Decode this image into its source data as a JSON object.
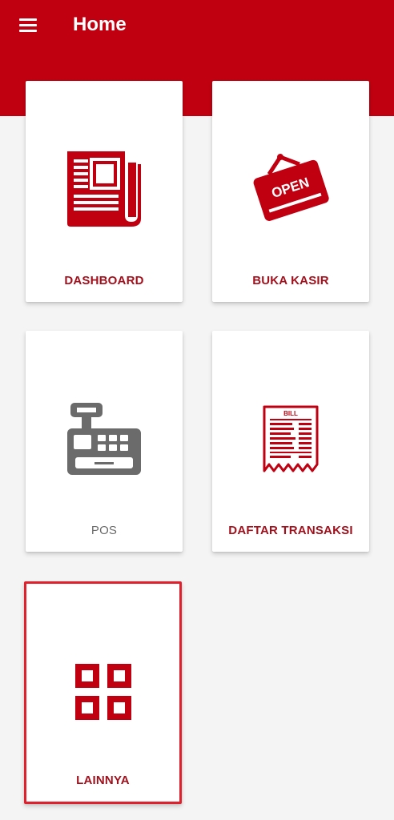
{
  "appbar": {
    "title": "Home",
    "menu_icon": "hamburger-menu-icon"
  },
  "colors": {
    "primary": "#c00010",
    "label_red": "#a3101c",
    "label_grey": "#6a6a6a",
    "selected_border": "#e0202c"
  },
  "menu": [
    {
      "label": "DASHBOARD",
      "icon": "newspaper-icon"
    },
    {
      "label": "BUKA KASIR",
      "icon": "open-sign-icon",
      "sign_text": "OPEN"
    },
    {
      "label": "POS",
      "icon": "cash-register-icon"
    },
    {
      "label": "DAFTAR TRANSAKSI",
      "icon": "bill-receipt-icon",
      "bill_text": "BILL"
    },
    {
      "label": "LAINNYA",
      "icon": "grid-icon",
      "selected": true
    }
  ]
}
